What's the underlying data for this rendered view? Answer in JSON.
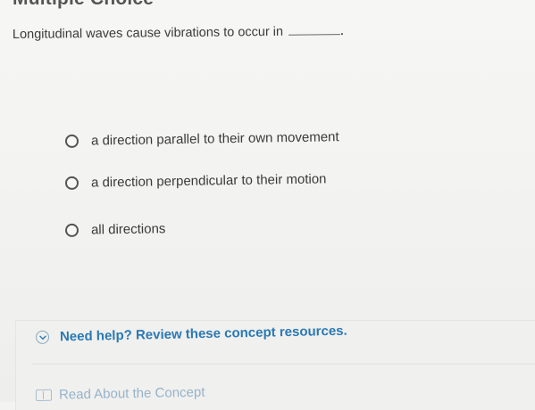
{
  "header": {
    "title_partial": "Multiple Choice"
  },
  "question": {
    "text": "Longitudinal waves cause vibrations to occur in"
  },
  "options": [
    {
      "label": "a direction parallel to their own movement",
      "selected": false
    },
    {
      "label": "a direction perpendicular to their motion",
      "selected": false
    },
    {
      "label": "all directions",
      "selected": false
    }
  ],
  "help": {
    "toggle_label": "Need help? Review these concept resources.",
    "read_link": "Read About the Concept"
  },
  "icons": {
    "radio": "radio-unselected-icon",
    "chevron": "chevron-down-circle-icon",
    "book": "book-icon"
  },
  "colors": {
    "link_blue": "#2a79b4",
    "text": "#3a3a3a",
    "background": "#f3f3f1"
  }
}
